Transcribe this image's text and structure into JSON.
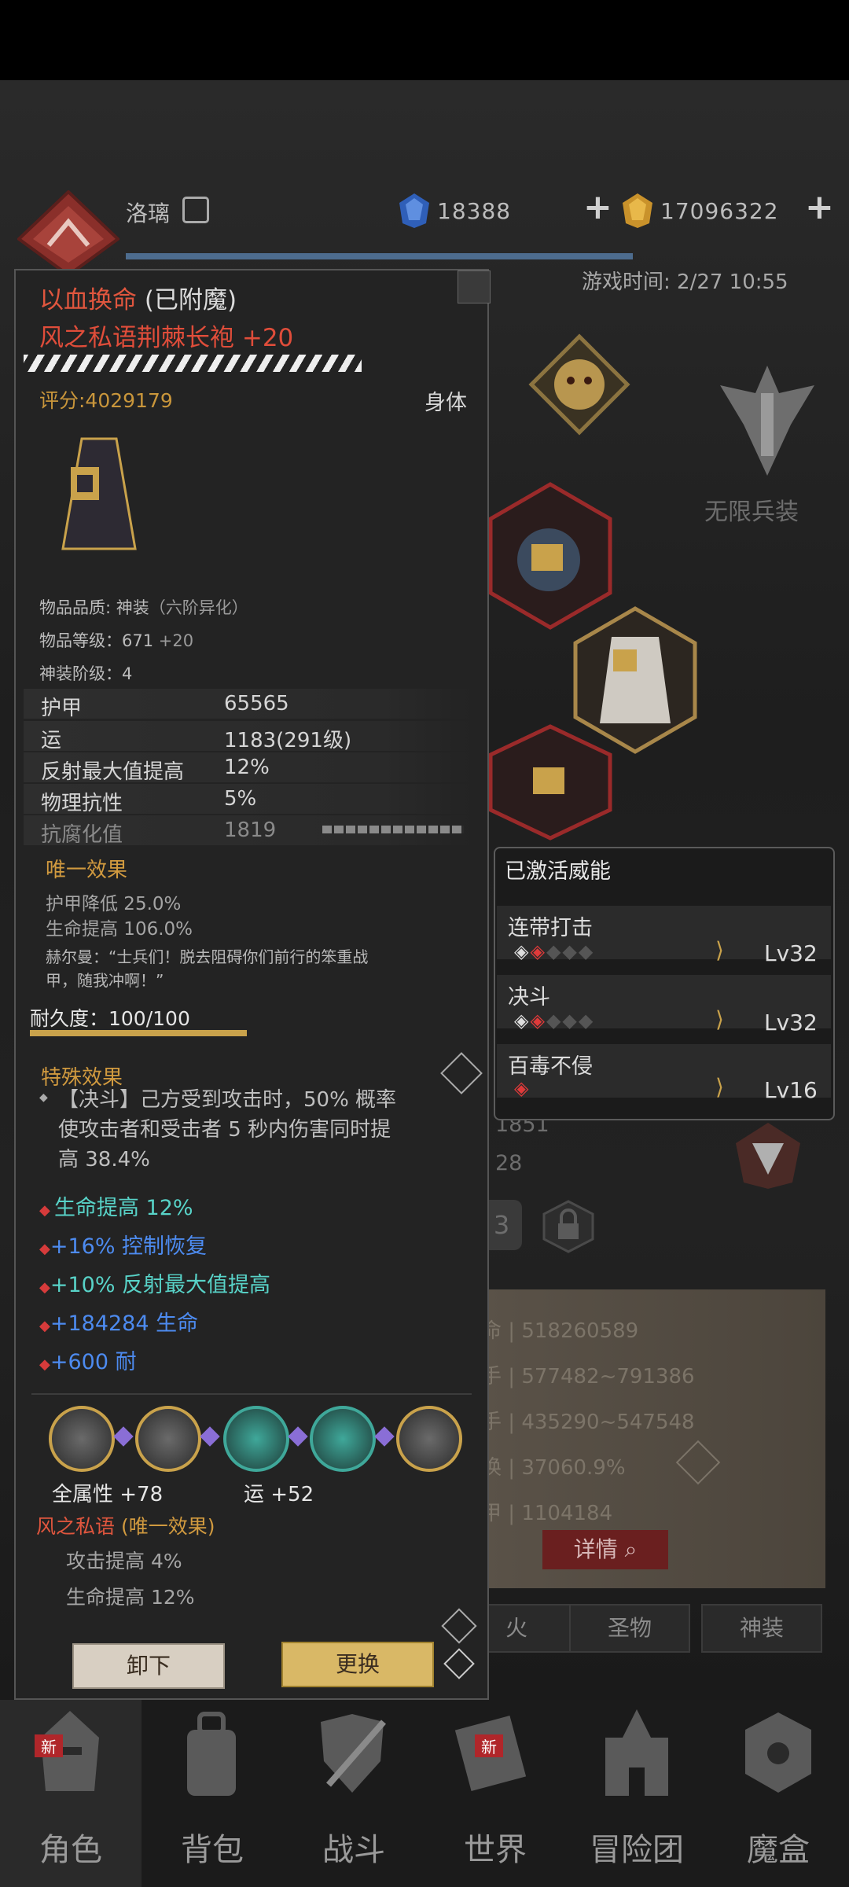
{
  "header": {
    "player_name": "洛璃",
    "currency1": "18388",
    "currency2": "17096322",
    "game_time": "游戏时间: 2/27 10:55"
  },
  "right_panel": {
    "infinite_arms_label": "无限兵装",
    "partial_num1": "1851",
    "partial_num2": "28",
    "stats": [
      {
        "prefix": "命",
        "value": "518260589"
      },
      {
        "prefix": "手",
        "value": "577482~791386"
      },
      {
        "prefix": "手",
        "value": "435290~547548"
      },
      {
        "prefix": "换",
        "value": "37060.9%"
      },
      {
        "prefix": "甲",
        "value": "1104184"
      }
    ],
    "detail_button": "详情",
    "tabs": [
      "火",
      "圣物",
      "神装"
    ]
  },
  "item": {
    "enchant_name": "以血换命",
    "enchant_suffix": "(已附魔)",
    "name": "风之私语荆棘长袍 +20",
    "score": "评分:4029179",
    "slot": "身体",
    "quality_label": "物品品质: 神装",
    "quality_note": "（六阶异化）",
    "level_label": "物品等级：671",
    "level_bonus": "+20",
    "divine_level": "神装阶级：4",
    "attributes": [
      {
        "label": "护甲",
        "value": "65565"
      },
      {
        "label": "运",
        "value": "1183(291级)"
      },
      {
        "label": "反射最大值提高",
        "value": "12%"
      },
      {
        "label": "物理抗性",
        "value": "5%"
      },
      {
        "label": "抗腐化值",
        "value": "1819"
      }
    ],
    "unique_title": "唯一效果",
    "unique_effects": [
      "护甲降低 25.0%",
      "生命提高 106.0%"
    ],
    "quote_line1": "赫尔曼：“士兵们！脱去阻碍你们前行的笨重战",
    "quote_line2": "甲，随我冲啊！”",
    "durability": "耐久度：100/100",
    "durability_fraction": 1.0,
    "special_title": "特殊效果",
    "special_desc_line1": "【决斗】己方受到攻击时，50% 概率",
    "special_desc_line2": "使攻击者和受击者 5 秒内伤害同时提",
    "special_desc_line3": "高 38.4%",
    "bonus_lines": [
      {
        "text": "生命提高 12%",
        "color": "#58d3c8"
      },
      {
        "text": "+16% 控制恢复",
        "color": "#4d8bf0"
      },
      {
        "text": "+10% 反射最大值提高",
        "color": "#58d3c8"
      },
      {
        "text": "+184284 生命",
        "color": "#4d8bf0"
      },
      {
        "text": "+600 耐",
        "color": "#4d8bf0"
      }
    ],
    "socket_stat1": "全属性 +78",
    "socket_stat2": "运  +52",
    "set_name": "风之私语",
    "set_suffix": "(唯一效果)",
    "set_effects": [
      "攻击提高 4%",
      "生命提高 12%"
    ],
    "unequip_button": "卸下",
    "replace_button": "更换"
  },
  "power_popup": {
    "title": "已激活威能",
    "powers": [
      {
        "name": "连带打击",
        "level": "Lv32"
      },
      {
        "name": "决斗",
        "level": "Lv32"
      },
      {
        "name": "百毒不侵",
        "level": "Lv16"
      }
    ]
  },
  "nav": {
    "new_badge": "新",
    "tabs": [
      "角色",
      "背包",
      "战斗",
      "世界",
      "冒险团",
      "魔盒"
    ]
  }
}
